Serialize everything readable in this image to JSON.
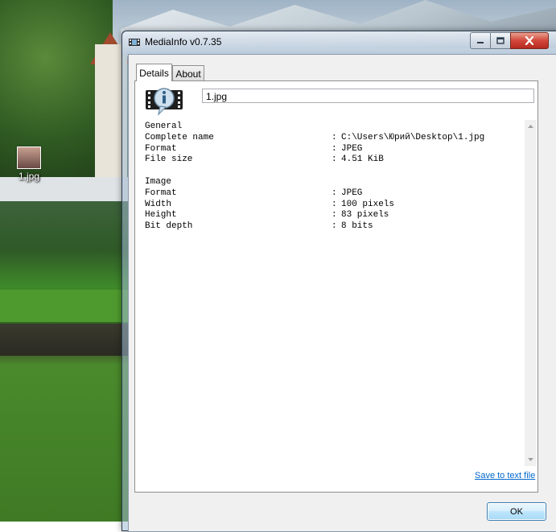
{
  "desktop": {
    "icon_label": "1.jpg"
  },
  "window": {
    "title": "MediaInfo v0.7.35"
  },
  "tabs": [
    {
      "label": "Details",
      "active": true
    },
    {
      "label": "About",
      "active": false
    }
  ],
  "file_field": {
    "value": "1.jpg"
  },
  "info": {
    "rows": [
      {
        "key": "General",
        "sep": "",
        "value": ""
      },
      {
        "key": "Complete name",
        "sep": ":",
        "value": "C:\\Users\\Юрий\\Desktop\\1.jpg"
      },
      {
        "key": "Format",
        "sep": ":",
        "value": "JPEG"
      },
      {
        "key": "File size",
        "sep": ":",
        "value": "4.51 KiB"
      },
      {
        "key": "",
        "sep": "",
        "value": ""
      },
      {
        "key": "Image",
        "sep": "",
        "value": ""
      },
      {
        "key": "Format",
        "sep": ":",
        "value": "JPEG"
      },
      {
        "key": "Width",
        "sep": ":",
        "value": "100 pixels"
      },
      {
        "key": "Height",
        "sep": ":",
        "value": "83 pixels"
      },
      {
        "key": "Bit depth",
        "sep": ":",
        "value": "8 bits"
      }
    ]
  },
  "links": {
    "save_to_text": "Save to text file"
  },
  "buttons": {
    "ok": "OK"
  },
  "colors": {
    "link": "#0066cc",
    "close_button": "#c4382c"
  }
}
